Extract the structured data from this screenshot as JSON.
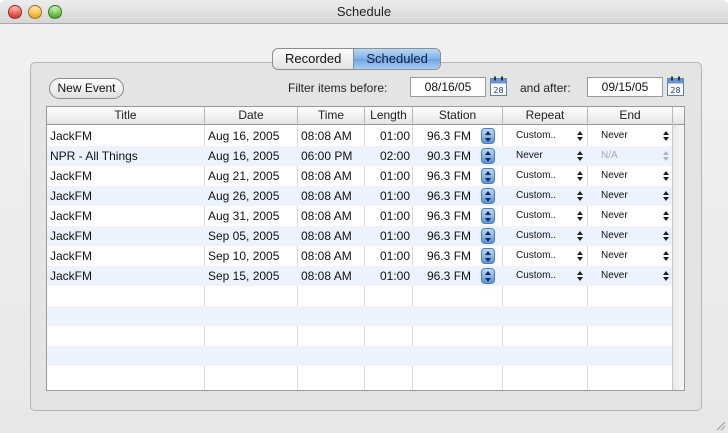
{
  "window": {
    "title": "Schedule"
  },
  "tabs": [
    {
      "label": "Recorded",
      "selected": false
    },
    {
      "label": "Scheduled",
      "selected": true
    }
  ],
  "toolbar": {
    "new_event_label": "New Event",
    "filter_before_label": "Filter items before:",
    "filter_before_value": "08/16/05",
    "filter_after_label": "and after:",
    "filter_after_value": "09/15/05",
    "calendar_day": "28"
  },
  "table": {
    "columns": [
      "Title",
      "Date",
      "Time",
      "Length",
      "Station",
      "Repeat",
      "End"
    ],
    "rows": [
      {
        "title": "JackFM",
        "date": "Aug 16, 2005",
        "time": "08:08 AM",
        "length": "01:00",
        "station": "96.3 FM",
        "repeat": "Custom..",
        "end": "Never",
        "end_disabled": false
      },
      {
        "title": "NPR - All Things",
        "date": "Aug 16, 2005",
        "time": "06:00 PM",
        "length": "02:00",
        "station": "90.3 FM",
        "repeat": "Never",
        "end": "N/A",
        "end_disabled": true
      },
      {
        "title": "JackFM",
        "date": "Aug 21, 2005",
        "time": "08:08 AM",
        "length": "01:00",
        "station": "96.3 FM",
        "repeat": "Custom..",
        "end": "Never",
        "end_disabled": false
      },
      {
        "title": "JackFM",
        "date": "Aug 26, 2005",
        "time": "08:08 AM",
        "length": "01:00",
        "station": "96.3 FM",
        "repeat": "Custom..",
        "end": "Never",
        "end_disabled": false
      },
      {
        "title": "JackFM",
        "date": "Aug 31, 2005",
        "time": "08:08 AM",
        "length": "01:00",
        "station": "96.3 FM",
        "repeat": "Custom..",
        "end": "Never",
        "end_disabled": false
      },
      {
        "title": "JackFM",
        "date": "Sep 05, 2005",
        "time": "08:08 AM",
        "length": "01:00",
        "station": "96.3 FM",
        "repeat": "Custom..",
        "end": "Never",
        "end_disabled": false
      },
      {
        "title": "JackFM",
        "date": "Sep 10, 2005",
        "time": "08:08 AM",
        "length": "01:00",
        "station": "96.3 FM",
        "repeat": "Custom..",
        "end": "Never",
        "end_disabled": false
      },
      {
        "title": "JackFM",
        "date": "Sep 15, 2005",
        "time": "08:08 AM",
        "length": "01:00",
        "station": "96.3 FM",
        "repeat": "Custom..",
        "end": "Never",
        "end_disabled": false
      }
    ],
    "empty_rows": 5
  },
  "colors": {
    "accent": "#7fb1e8",
    "row_alt": "#edf3fe"
  }
}
